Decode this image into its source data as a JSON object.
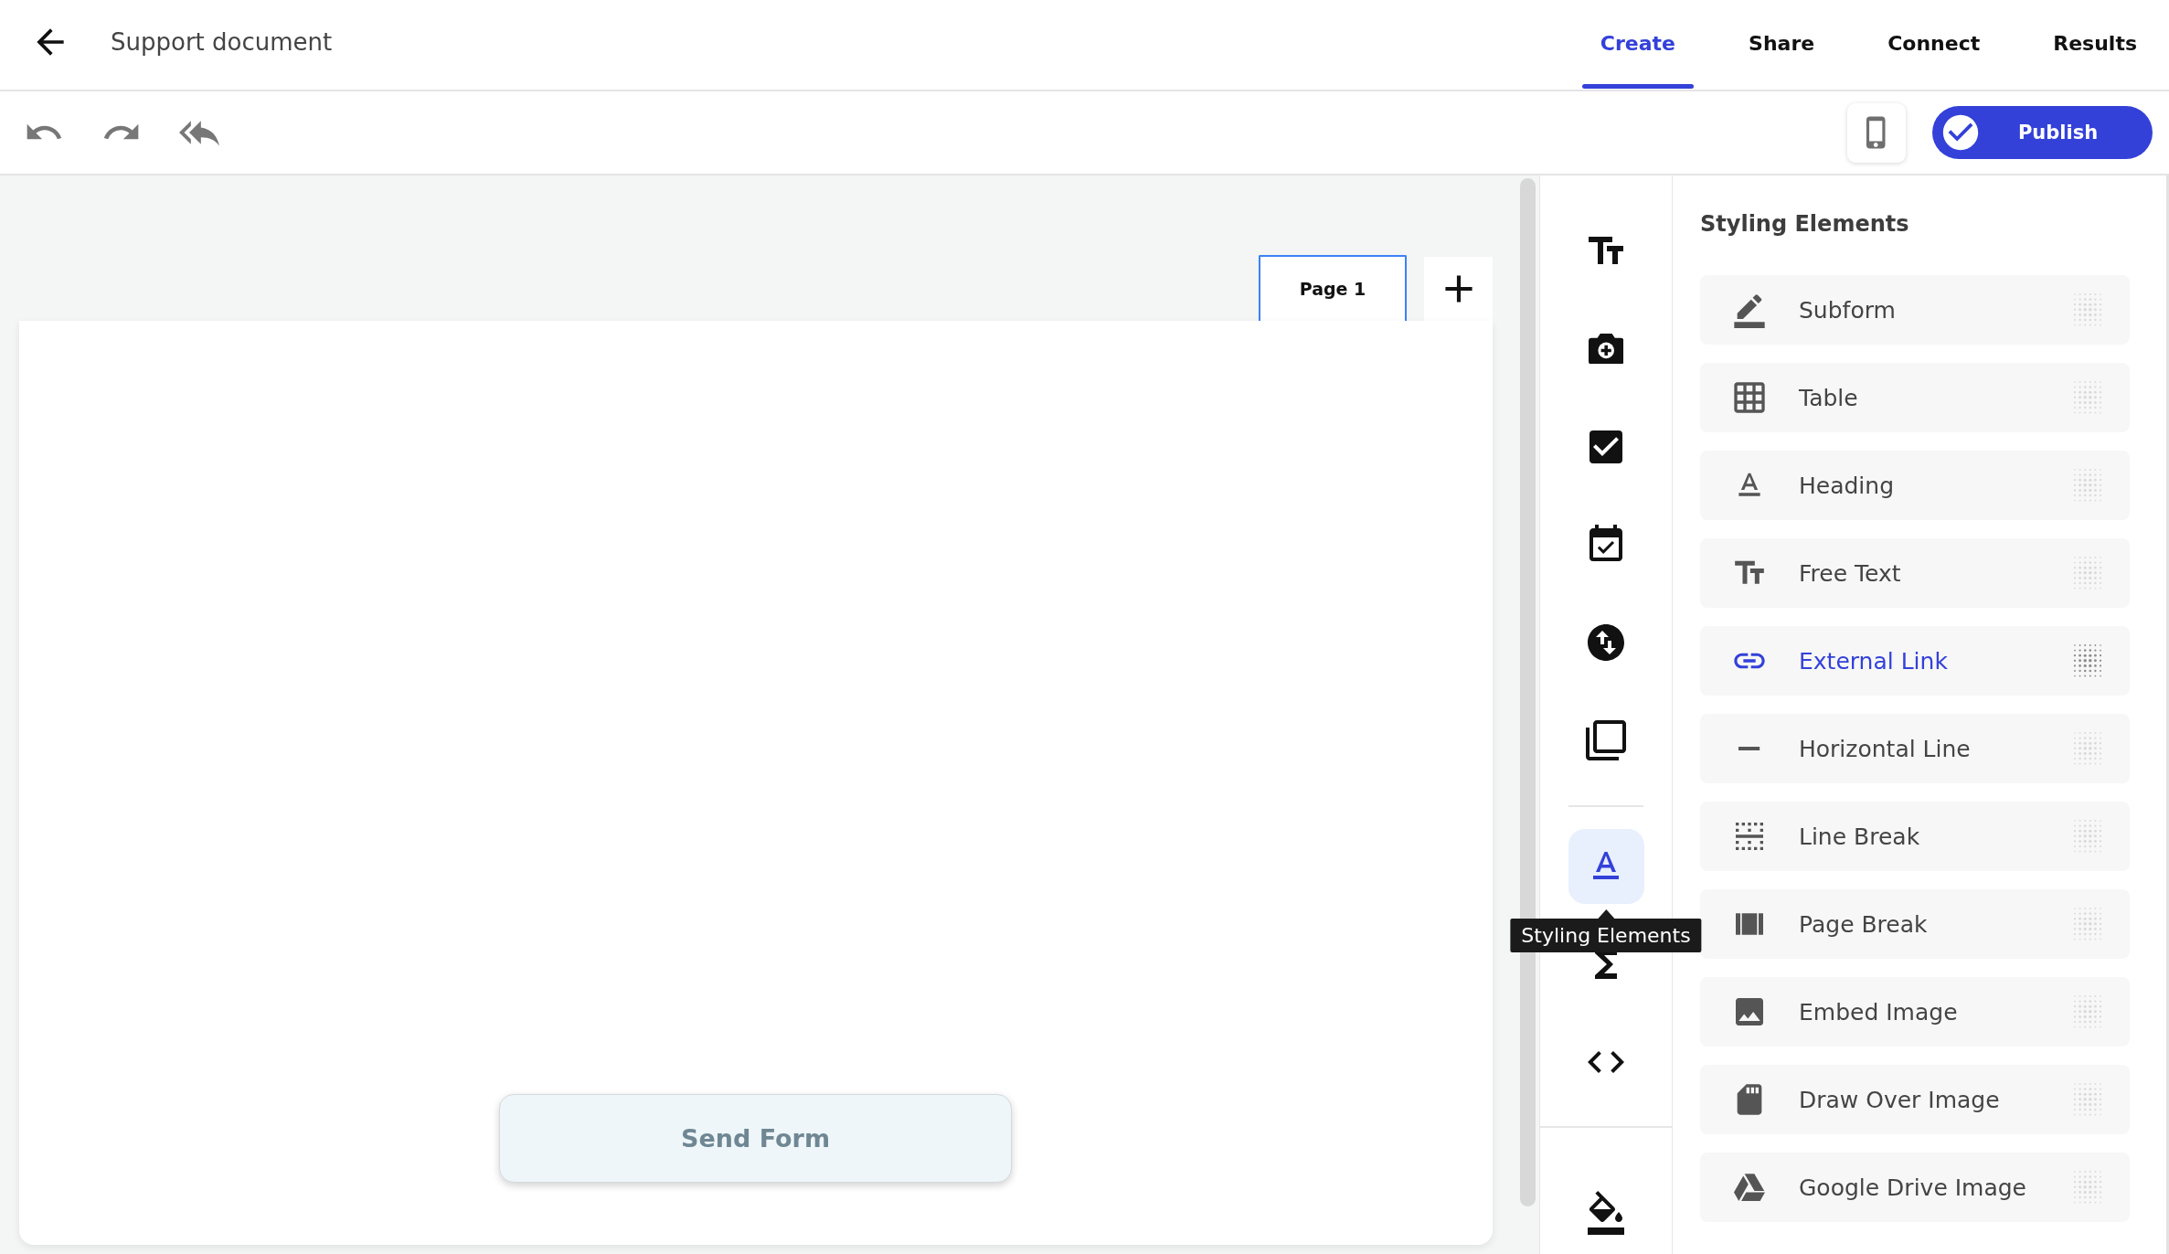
{
  "header": {
    "title": "Support document",
    "tabs": [
      {
        "label": "Create",
        "selected": true
      },
      {
        "label": "Share",
        "selected": false
      },
      {
        "label": "Connect",
        "selected": false
      },
      {
        "label": "Results",
        "selected": false
      }
    ]
  },
  "toolbar": {
    "publish": {
      "label": "Publish"
    }
  },
  "canvas": {
    "pages": [
      {
        "label": "Page 1",
        "selected": true
      }
    ],
    "submit": {
      "label": "Send Form",
      "disabled": true
    }
  },
  "rail": {
    "groups": [
      {
        "items": [
          {
            "kind": "text",
            "selected": false
          },
          {
            "kind": "photo",
            "selected": false
          },
          {
            "kind": "checkbox",
            "selected": false
          },
          {
            "kind": "date",
            "selected": false
          },
          {
            "kind": "swap",
            "selected": false
          },
          {
            "kind": "copy",
            "selected": false
          }
        ]
      },
      {
        "items": [
          {
            "kind": "styling",
            "selected": true,
            "tooltip": "Styling Elements"
          },
          {
            "kind": "sigma",
            "selected": false
          },
          {
            "kind": "code",
            "selected": false
          }
        ]
      },
      {
        "items": [
          {
            "kind": "fill",
            "selected": false
          }
        ]
      }
    ]
  },
  "panel": {
    "title": "Styling Elements",
    "items": [
      {
        "label": "Subform",
        "kind": "subform",
        "highlighted": false
      },
      {
        "label": "Table",
        "kind": "table",
        "highlighted": false
      },
      {
        "label": "Heading",
        "kind": "heading",
        "highlighted": false
      },
      {
        "label": "Free Text",
        "kind": "text",
        "highlighted": false
      },
      {
        "label": "External Link",
        "kind": "link",
        "highlighted": true
      },
      {
        "label": "Horizontal Line",
        "kind": "line",
        "highlighted": false
      },
      {
        "label": "Line Break",
        "kind": "linebreak",
        "highlighted": false
      },
      {
        "label": "Page Break",
        "kind": "pagebreak",
        "highlighted": false
      },
      {
        "label": "Embed Image",
        "kind": "image",
        "highlighted": false
      },
      {
        "label": "Draw Over Image",
        "kind": "draw",
        "highlighted": false
      },
      {
        "label": "Google Drive Image",
        "kind": "drive",
        "highlighted": false
      }
    ]
  }
}
